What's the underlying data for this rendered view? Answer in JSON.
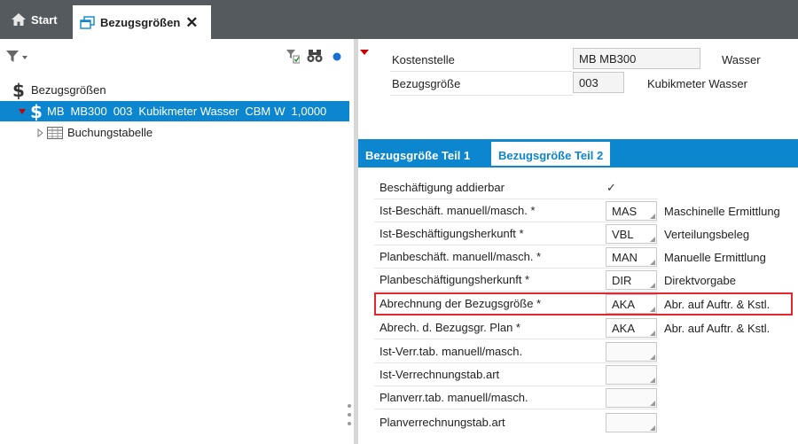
{
  "tabs": {
    "start_label": "Start",
    "active_label": "Bezugsgrößen",
    "close_glyph": "✕"
  },
  "left": {
    "tree": {
      "root_label": "Bezugsgrößen",
      "selected_item": {
        "kostenrechnungskreis": "MB",
        "kostenstelle": "MB300",
        "bezugsgroesse": "003",
        "text": "Kubikmeter Wasser",
        "einheit": "CBM",
        "typ": "W",
        "wert": "1,0000"
      },
      "child_label": "Buchungstabelle"
    },
    "toolbar": {
      "filter_icon": "filter-icon",
      "checklist_icon": "checklist-filter-icon",
      "binoculars_icon": "binoculars-icon",
      "dot_icon": "status-dot-icon"
    }
  },
  "header": {
    "kostenstelle_label": "Kostenstelle",
    "kostenstelle_value": "MB MB300",
    "kostenstelle_text": "Wasser",
    "bezugsgroesse_label": "Bezugsgröße",
    "bezugsgroesse_value": "003",
    "bezugsgroesse_text": "Kubikmeter Wasser"
  },
  "detail_tabs": [
    {
      "label": "Bezugsgröße Teil 1",
      "active": false
    },
    {
      "label": "Bezugsgröße Teil 2",
      "active": true
    }
  ],
  "fields": [
    {
      "label": "Beschäftigung addierbar",
      "type": "checkbox",
      "checked": true,
      "check_glyph": "✓"
    },
    {
      "label": "Ist-Beschäft. manuell/masch. *",
      "code": "MAS",
      "desc": "Maschinelle Ermittlung"
    },
    {
      "label": "Ist-Beschäftigungsherkunft *",
      "code": "VBL",
      "desc": "Verteilungsbeleg"
    },
    {
      "label": "Planbeschäft. manuell/masch. *",
      "code": "MAN",
      "desc": "Manuelle Ermittlung"
    },
    {
      "label": "Planbeschäftigungsherkunft *",
      "code": "DIR",
      "desc": "Direktvorgabe"
    },
    {
      "label": "Abrechnung der Bezugsgröße *",
      "code": "AKA",
      "desc": "Abr. auf Auftr. & Kstl.",
      "highlighted": true
    },
    {
      "label": "Abrech. d. Bezugsgr. Plan *",
      "code": "AKA",
      "desc": "Abr. auf Auftr. & Kstl."
    },
    {
      "label": "Ist-Verr.tab. manuell/masch.",
      "code": "",
      "desc": ""
    },
    {
      "label": "Ist-Verrechnungstab.art",
      "code": "",
      "desc": ""
    },
    {
      "label": "Planverr.tab. manuell/masch.",
      "code": "",
      "desc": ""
    },
    {
      "label": "Planverrechnungstab.art",
      "code": "",
      "desc": ""
    }
  ],
  "colors": {
    "topbar": "#555a5e",
    "accent_blue": "#0c86ce",
    "highlight_red": "#e0282e",
    "expand_red": "#cc0000"
  }
}
